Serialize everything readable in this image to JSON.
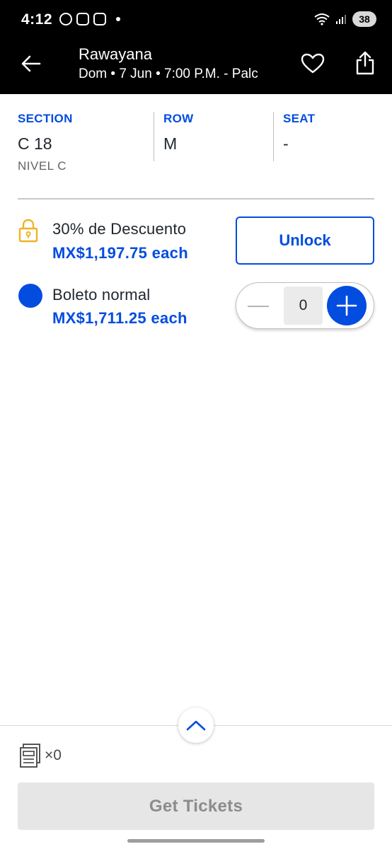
{
  "status_bar": {
    "time": "4:12",
    "battery": "38"
  },
  "header": {
    "title": "Rawayana",
    "subtitle": "Dom • 7 Jun • 7:00 P.M. - Palc"
  },
  "seat": {
    "section_label": "SECTION",
    "section_value": "C 18",
    "section_sub": "NIVEL C",
    "row_label": "ROW",
    "row_value": "M",
    "seat_label": "SEAT",
    "seat_value": "-"
  },
  "offers": [
    {
      "name": "30% de Descuento",
      "price": "MX$1,197.75 each",
      "action_label": "Unlock",
      "icon": "lock-icon"
    },
    {
      "name": "Boleto normal",
      "price": "MX$1,711.25 each",
      "quantity": "0",
      "icon": "blue-dot-icon"
    }
  ],
  "cart": {
    "count": "×0"
  },
  "cta": {
    "label": "Get Tickets"
  },
  "colors": {
    "accent": "#024ddf",
    "lock": "#f0b323",
    "header_bg": "#000000"
  }
}
